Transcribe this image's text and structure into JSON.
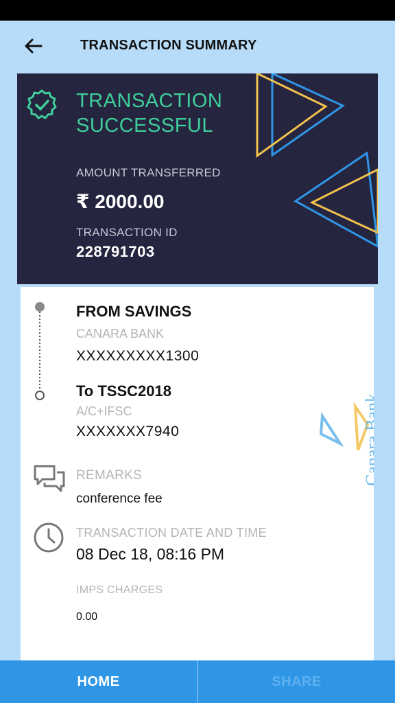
{
  "header": {
    "title": "TRANSACTION SUMMARY",
    "back_icon": "arrow-left-icon"
  },
  "hero": {
    "status_line1": "TRANSACTION",
    "status_line2": "SUCCESSFUL",
    "amount_label": "AMOUNT TRANSFERRED",
    "amount_value": "₹ 2000.00",
    "txn_id_label": "TRANSACTION ID",
    "txn_id_value": "228791703",
    "accent_color": "#3fcf9b",
    "background_color": "#262540"
  },
  "from": {
    "title": "FROM SAVINGS",
    "bank": "CANARA BANK",
    "account": "XXXXXXXXX1300"
  },
  "to": {
    "title": "To TSSC2018",
    "type": "A/C+IFSC",
    "account": "XXXXXXX7940"
  },
  "remarks": {
    "label": "REMARKS",
    "value": "conference fee",
    "icon": "chat-icon"
  },
  "datetime": {
    "label": "TRANSACTION DATE AND TIME",
    "value": "08 Dec 18, 08:16 PM",
    "icon": "clock-icon"
  },
  "imps": {
    "label": "IMPS CHARGES",
    "value": "0.00"
  },
  "watermark": {
    "text": "Canara Bank"
  },
  "actions": {
    "home": "HOME",
    "share": "SHARE"
  }
}
